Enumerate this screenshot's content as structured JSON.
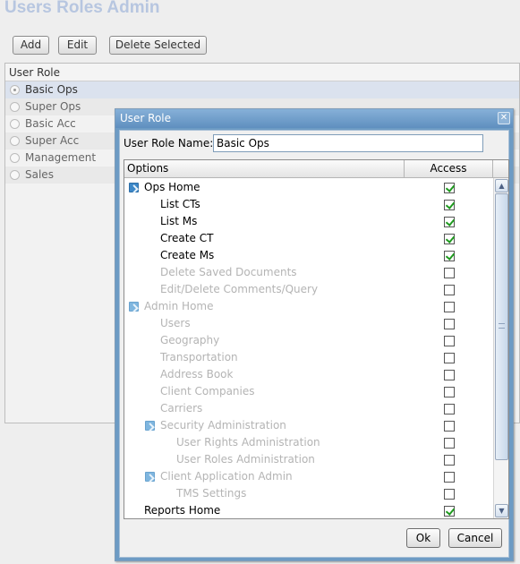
{
  "page": {
    "title": "Users Roles Admin"
  },
  "toolbar": {
    "add_label": "Add",
    "edit_label": "Edit",
    "delete_label": "Delete Selected"
  },
  "roles": {
    "header": "User Role",
    "items": [
      {
        "label": "Basic Ops",
        "selected": true
      },
      {
        "label": "Super Ops",
        "selected": false
      },
      {
        "label": "Basic Acc",
        "selected": false
      },
      {
        "label": "Super Acc",
        "selected": false
      },
      {
        "label": "Management",
        "selected": false
      },
      {
        "label": "Sales",
        "selected": false
      }
    ]
  },
  "dialog": {
    "title": "User Role",
    "close_icon": "close-icon",
    "name_label": "User Role Name:",
    "name_value": "Basic Ops",
    "columns": {
      "options": "Options",
      "access": "Access"
    },
    "options": [
      {
        "label": "Ops Home",
        "level": 0,
        "expandable": true,
        "enabled": true,
        "checked": true
      },
      {
        "label": "List CTs",
        "level": 1,
        "expandable": false,
        "enabled": true,
        "checked": true
      },
      {
        "label": "List Ms",
        "level": 1,
        "expandable": false,
        "enabled": true,
        "checked": true
      },
      {
        "label": "Create CT",
        "level": 1,
        "expandable": false,
        "enabled": true,
        "checked": true
      },
      {
        "label": "Create Ms",
        "level": 1,
        "expandable": false,
        "enabled": true,
        "checked": true
      },
      {
        "label": "Delete Saved Documents",
        "level": 1,
        "expandable": false,
        "enabled": false,
        "checked": false
      },
      {
        "label": "Edit/Delete Comments/Query",
        "level": 1,
        "expandable": false,
        "enabled": false,
        "checked": false
      },
      {
        "label": "Admin Home",
        "level": 0,
        "expandable": true,
        "enabled": false,
        "checked": false
      },
      {
        "label": "Users",
        "level": 1,
        "expandable": false,
        "enabled": false,
        "checked": false
      },
      {
        "label": "Geography",
        "level": 1,
        "expandable": false,
        "enabled": false,
        "checked": false
      },
      {
        "label": "Transportation",
        "level": 1,
        "expandable": false,
        "enabled": false,
        "checked": false
      },
      {
        "label": "Address Book",
        "level": 1,
        "expandable": false,
        "enabled": false,
        "checked": false
      },
      {
        "label": "Client Companies",
        "level": 1,
        "expandable": false,
        "enabled": false,
        "checked": false
      },
      {
        "label": "Carriers",
        "level": 1,
        "expandable": false,
        "enabled": false,
        "checked": false
      },
      {
        "label": "Security Administration",
        "level": 1,
        "expandable": true,
        "enabled": false,
        "checked": false
      },
      {
        "label": "User Rights Administration",
        "level": 2,
        "expandable": false,
        "enabled": false,
        "checked": false
      },
      {
        "label": "User Roles Administration",
        "level": 2,
        "expandable": false,
        "enabled": false,
        "checked": false
      },
      {
        "label": "Client Application Admin",
        "level": 1,
        "expandable": true,
        "enabled": false,
        "checked": false
      },
      {
        "label": "TMS Settings",
        "level": 2,
        "expandable": false,
        "enabled": false,
        "checked": false
      },
      {
        "label": "Reports Home",
        "level": 0,
        "expandable": false,
        "enabled": true,
        "checked": true
      }
    ],
    "ok_label": "Ok",
    "cancel_label": "Cancel"
  }
}
